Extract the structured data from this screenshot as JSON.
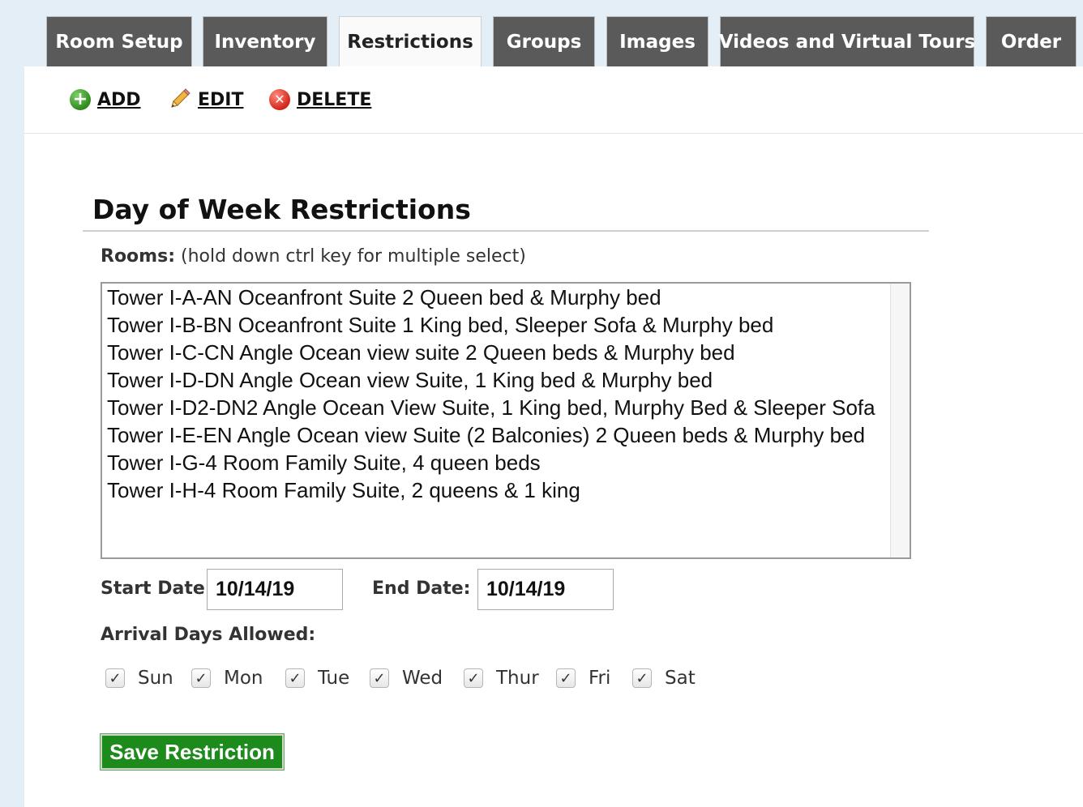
{
  "tabs": [
    {
      "label": "Room Setup",
      "active": false
    },
    {
      "label": "Inventory",
      "active": false
    },
    {
      "label": "Restrictions",
      "active": true
    },
    {
      "label": "Groups",
      "active": false
    },
    {
      "label": "Images",
      "active": false
    },
    {
      "label": "Videos and Virtual Tours",
      "active": false
    },
    {
      "label": "Order",
      "active": false
    }
  ],
  "toolbar": {
    "add_label": "ADD",
    "edit_label": "EDIT",
    "delete_label": "DELETE",
    "add_icon": "plus-circle-icon",
    "edit_icon": "pencil-icon",
    "delete_icon": "x-circle-icon"
  },
  "form": {
    "title": "Day of Week Restrictions",
    "rooms_label": "Rooms:",
    "rooms_hint": "(hold down ctrl key for multiple select)",
    "rooms": [
      "Tower I-A-AN Oceanfront Suite 2 Queen bed & Murphy bed",
      "Tower I-B-BN Oceanfront Suite 1 King bed, Sleeper Sofa & Murphy bed",
      "Tower I-C-CN Angle Ocean view suite 2 Queen beds & Murphy bed",
      "Tower I-D-DN Angle Ocean view Suite, 1 King bed & Murphy bed",
      "Tower I-D2-DN2 Angle Ocean View Suite, 1 King bed, Murphy Bed & Sleeper Sofa",
      "Tower I-E-EN Angle Ocean view Suite (2 Balconies) 2 Queen beds & Murphy bed",
      "Tower I-G-4 Room Family Suite, 4 queen beds",
      "Tower I-H-4 Room Family Suite, 2 queens & 1 king"
    ],
    "start_date_label": "Start Date:",
    "start_date": "10/14/19",
    "end_date_label": "End Date:",
    "end_date": "10/14/19",
    "arrival_label": "Arrival Days Allowed:",
    "days": [
      {
        "label": "Sun",
        "checked": true
      },
      {
        "label": "Mon",
        "checked": true
      },
      {
        "label": "Tue",
        "checked": true
      },
      {
        "label": "Wed",
        "checked": true
      },
      {
        "label": "Thur",
        "checked": true
      },
      {
        "label": "Fri",
        "checked": true
      },
      {
        "label": "Sat",
        "checked": true
      }
    ],
    "save_label": "Save Restriction"
  },
  "colors": {
    "tab_bg": "#5a5a5a",
    "tab_active_bg": "#fafafa",
    "save_button": "#1d8a1c",
    "page_bg": "#e4eef7"
  }
}
